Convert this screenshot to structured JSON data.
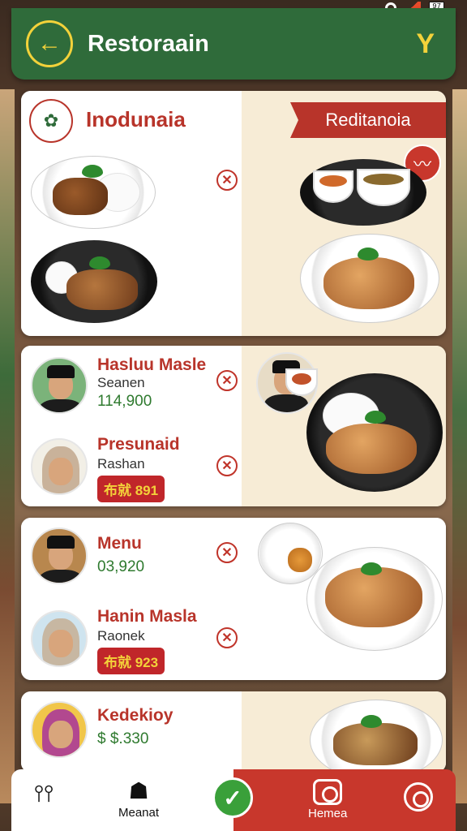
{
  "status_bar": {
    "battery": "97"
  },
  "header": {
    "title": "Restoraain"
  },
  "card1": {
    "title": "Inodunaia",
    "ribbon": "Reditanoia"
  },
  "card2": {
    "people": [
      {
        "name": "Hasluu Masle",
        "sub": "Seanen",
        "price": "114,900"
      },
      {
        "name": "Presunaid",
        "sub": "Rashan",
        "price_tag": "布就 891"
      }
    ]
  },
  "card3": {
    "people": [
      {
        "name": "Menu",
        "price": "03,920"
      },
      {
        "name": "Hanin Masla",
        "sub": "Raonek",
        "price_tag": "布就 923"
      }
    ]
  },
  "card4": {
    "people": [
      {
        "name": "Kedekioy",
        "price": "$ $.330"
      }
    ]
  },
  "nav": {
    "items": [
      {
        "label": ""
      },
      {
        "label": "Meanat"
      },
      {
        "label": "Hemea"
      },
      {
        "label": ""
      }
    ]
  },
  "colors": {
    "header_green": "#2f6b3a",
    "accent_red": "#b8342a",
    "accent_yellow": "#f3d23a",
    "price_green": "#2f7a2f"
  },
  "icons": [
    "back-arrow-icon",
    "filter-icon",
    "logo-emblem-icon",
    "no-chili-icon",
    "spice-badge-icon",
    "utensils-icon",
    "chef-icon",
    "checkmark-icon",
    "camera-icon",
    "settings-icon"
  ]
}
